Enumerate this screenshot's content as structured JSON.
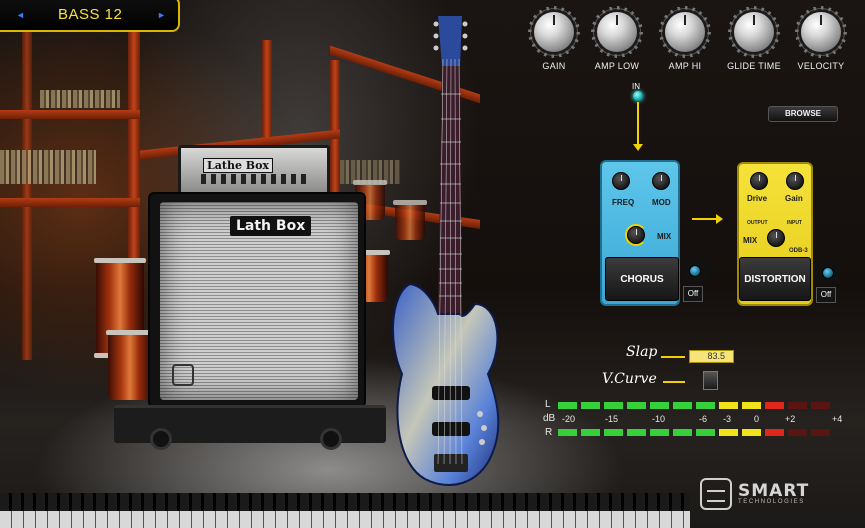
{
  "preset": {
    "name": "BASS 12",
    "prev_arrow": "◄",
    "next_arrow": "►"
  },
  "knobs": [
    {
      "label": "GAIN"
    },
    {
      "label": "AMP LOW"
    },
    {
      "label": "AMP HI"
    },
    {
      "label": "GLIDE TIME"
    },
    {
      "label": "VELOCITY"
    }
  ],
  "browse_label": "BROWSE",
  "in_label": "IN",
  "amp": {
    "head_logo": "Lathe Box",
    "cab_logo": "Lath Box"
  },
  "chorus": {
    "freq_label": "FREQ",
    "mod_label": "MOD",
    "mix_label": "MIX",
    "name": "CHORUS",
    "switch_label": "Off"
  },
  "distortion": {
    "drive_label": "Drive",
    "gain_label": "Gain",
    "output_label": "OUTPUT",
    "input_label": "INPUT",
    "mix_label": "MIX",
    "model": "ODB-3",
    "name": "DISTORTION",
    "switch_label": "Off"
  },
  "slap": {
    "label": "Slap",
    "value": "83.5"
  },
  "vcurve": {
    "label": "V.Curve"
  },
  "meter": {
    "l_label": "L",
    "db_label": "dB",
    "r_label": "R",
    "scale": [
      "-20",
      "-15",
      "-10",
      "-6",
      "-3",
      "0",
      "+2",
      "+4"
    ],
    "colors": {
      "green": "#35d03a",
      "yellow": "#f2e21a",
      "red": "#e0261d",
      "dim_red": "#5a1512"
    }
  },
  "brand": {
    "name": "SMART",
    "sub": "TECHNOLOGIES"
  }
}
